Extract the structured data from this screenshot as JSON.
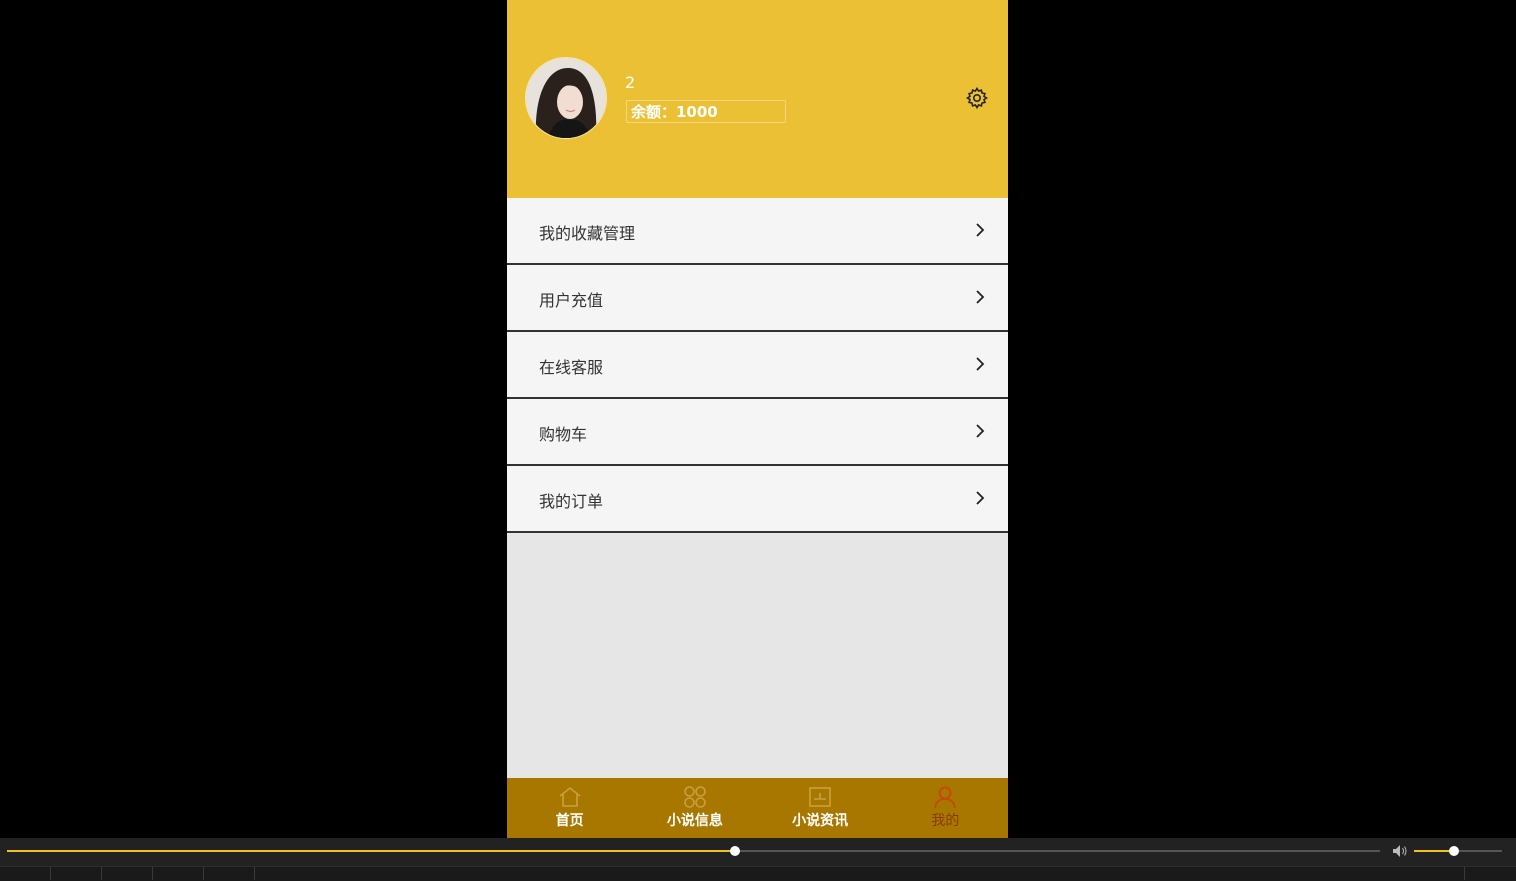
{
  "profile": {
    "username": "2",
    "balance": "余额：1000"
  },
  "icons": {
    "settings": "gear-icon",
    "chevron": "chevron-right-icon",
    "home": "home-icon",
    "novel_info": "clover-icon",
    "novel_news": "news-icon",
    "mine": "person-icon",
    "volume": "speaker-icon"
  },
  "menu": {
    "items": [
      {
        "label": "我的收藏管理"
      },
      {
        "label": "用户充值"
      },
      {
        "label": "在线客服"
      },
      {
        "label": "购物车"
      },
      {
        "label": "我的订单"
      }
    ]
  },
  "tabbar": {
    "items": [
      {
        "label": "首页"
      },
      {
        "label": "小说信息"
      },
      {
        "label": "小说资讯"
      },
      {
        "label": "我的"
      }
    ],
    "active_index": 3
  },
  "player": {
    "progress_fraction": 0.53,
    "volume_fraction": 0.45
  },
  "colors": {
    "header": "#ecc035",
    "tabbar": "#a77700",
    "active_tab": "#c9460c",
    "accent": "#f0c020"
  }
}
